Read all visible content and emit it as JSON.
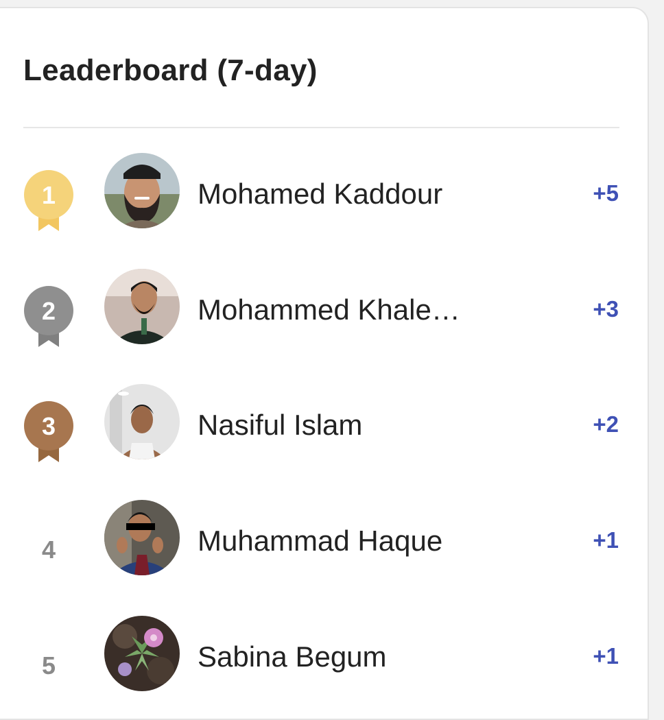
{
  "header": {
    "title": "Leaderboard (7-day)"
  },
  "colors": {
    "gold": "#F5D37A",
    "silver": "#8F8F8F",
    "bronze": "#A7764F",
    "score": "#3F51B5"
  },
  "leaderboard": [
    {
      "rank": "1",
      "name": "Mohamed Kaddour",
      "score": "+5",
      "badge": "gold"
    },
    {
      "rank": "2",
      "name": "Mohammed Khale…",
      "score": "+3",
      "badge": "silver"
    },
    {
      "rank": "3",
      "name": "Nasiful Islam",
      "score": "+2",
      "badge": "bronze"
    },
    {
      "rank": "4",
      "name": "Muhammad Haque",
      "score": "+1",
      "badge": "none"
    },
    {
      "rank": "5",
      "name": "Sabina Begum",
      "score": "+1",
      "badge": "none"
    }
  ]
}
